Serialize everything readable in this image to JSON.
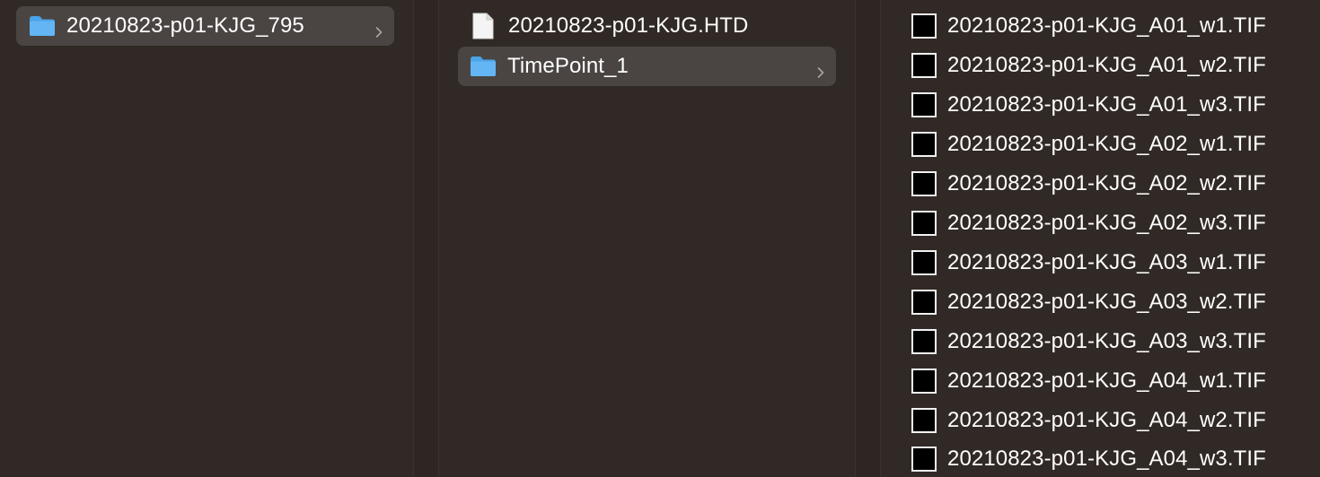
{
  "columns": [
    {
      "items": [
        {
          "label": "20210823-p01-KJG_795",
          "icon": "folder-icon",
          "selected": true,
          "has_children": true
        }
      ]
    },
    {
      "items": [
        {
          "label": "20210823-p01-KJG.HTD",
          "icon": "document-icon",
          "selected": false,
          "has_children": false
        },
        {
          "label": "TimePoint_1",
          "icon": "folder-icon",
          "selected": true,
          "has_children": true
        }
      ]
    },
    {
      "items": [
        {
          "label": "20210823-p01-KJG_A01_w1.TIF",
          "icon": "tif-thumbnail-icon"
        },
        {
          "label": "20210823-p01-KJG_A01_w2.TIF",
          "icon": "tif-thumbnail-icon"
        },
        {
          "label": "20210823-p01-KJG_A01_w3.TIF",
          "icon": "tif-thumbnail-icon"
        },
        {
          "label": "20210823-p01-KJG_A02_w1.TIF",
          "icon": "tif-thumbnail-icon"
        },
        {
          "label": "20210823-p01-KJG_A02_w2.TIF",
          "icon": "tif-thumbnail-icon"
        },
        {
          "label": "20210823-p01-KJG_A02_w3.TIF",
          "icon": "tif-thumbnail-icon"
        },
        {
          "label": "20210823-p01-KJG_A03_w1.TIF",
          "icon": "tif-thumbnail-icon"
        },
        {
          "label": "20210823-p01-KJG_A03_w2.TIF",
          "icon": "tif-thumbnail-icon"
        },
        {
          "label": "20210823-p01-KJG_A03_w3.TIF",
          "icon": "tif-thumbnail-icon"
        },
        {
          "label": "20210823-p01-KJG_A04_w1.TIF",
          "icon": "tif-thumbnail-icon"
        },
        {
          "label": "20210823-p01-KJG_A04_w2.TIF",
          "icon": "tif-thumbnail-icon"
        },
        {
          "label": "20210823-p01-KJG_A04_w3.TIF",
          "icon": "tif-thumbnail-icon"
        }
      ]
    }
  ],
  "colors": {
    "background": "#312925",
    "selection": "#4a4542",
    "folder": "#5aaff0",
    "text": "#ffffff",
    "chevron": "#a9a4a1"
  }
}
